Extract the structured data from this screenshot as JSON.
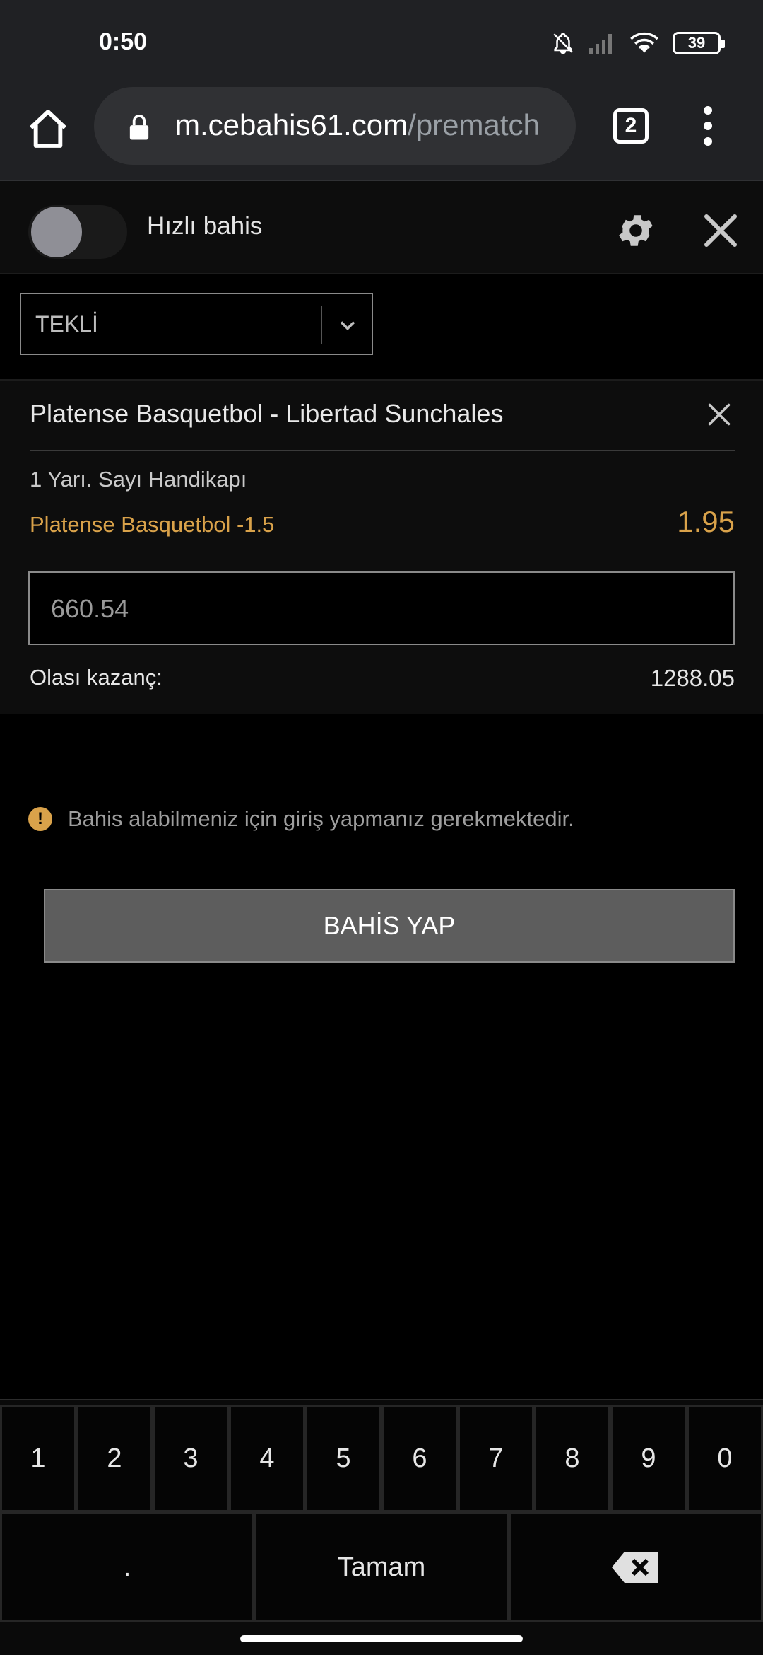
{
  "status_bar": {
    "time": "0:50",
    "battery": "39",
    "icons": [
      "bell-off-icon",
      "signal-icon",
      "wifi-icon",
      "battery-icon"
    ]
  },
  "browser": {
    "url_main": "m.cebahis61.com",
    "url_path": "/prematch",
    "tab_count": "2"
  },
  "quick_bet": {
    "label": "Hızlı bahis",
    "toggle_on": false
  },
  "bet_type": {
    "selected": "TEKLİ"
  },
  "slip": {
    "event": "Platense Basquetbol - Libertad Sunchales",
    "market": "1 Yarı. Sayı Handikapı",
    "selection": "Platense Basquetbol -1.5",
    "odds": "1.95",
    "stake": "660.54",
    "win_label": "Olası kazanç:",
    "win_value": "1288.05"
  },
  "warning": {
    "text": "Bahis alabilmeniz için giriş yapmanız gerekmektedir."
  },
  "bet_button": {
    "label": "BAHİS YAP"
  },
  "keypad": {
    "digits": [
      "1",
      "2",
      "3",
      "4",
      "5",
      "6",
      "7",
      "8",
      "9",
      "0"
    ],
    "dot": ".",
    "done": "Tamam"
  },
  "colors": {
    "accent": "#d9a24a",
    "background": "#000000",
    "panel": "#0d0d0d",
    "button": "#5d5d5d"
  }
}
